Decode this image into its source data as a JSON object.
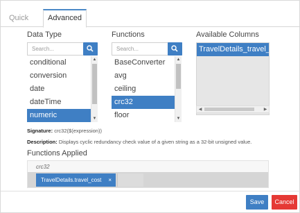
{
  "tabs": [
    {
      "label": "Quick"
    },
    {
      "label": "Advanced"
    }
  ],
  "data_type": {
    "label": "Data Type",
    "search_placeholder": "Search...",
    "items": [
      "conditional",
      "conversion",
      "date",
      "dateTime",
      "numeric"
    ],
    "selected": "numeric"
  },
  "functions": {
    "label": "Functions",
    "search_placeholder": "Search...",
    "items": [
      "BaseConverter",
      "avg",
      "ceiling",
      "crc32",
      "floor"
    ],
    "selected": "crc32"
  },
  "available_columns": {
    "label": "Available Columns",
    "items": [
      "TravelDetails_travel_cost"
    ]
  },
  "signature": {
    "label": "Signature:",
    "value": "crc32($(expression))"
  },
  "description": {
    "label": "Description:",
    "value": "Displays cyclic redundancy check value of a given string as a 32-bit unsigned value."
  },
  "functions_applied": {
    "label": "Functions Applied",
    "function_name": "crc32",
    "chip_label": "TravelDetails.travel_cost",
    "chip_remove": "×"
  },
  "buttons": {
    "save": "Save",
    "cancel": "Cancel"
  },
  "colors": {
    "accent": "#3f7fc4",
    "danger": "#e53935"
  }
}
